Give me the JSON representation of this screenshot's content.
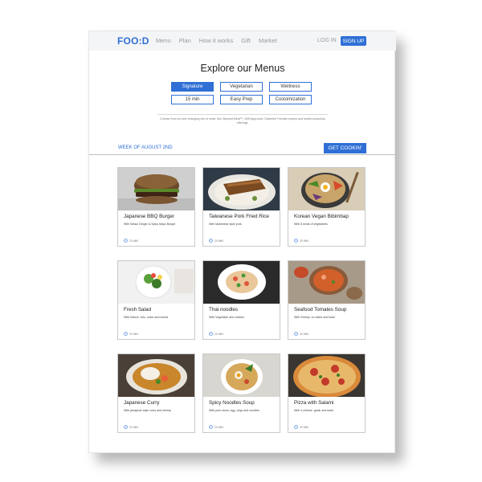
{
  "brand": {
    "logo": "FOO:D",
    "accent": "#2f6fd6"
  },
  "nav": [
    "Menu",
    "Plan",
    "How it works",
    "Gift",
    "Market"
  ],
  "auth": {
    "login": "LOG IN",
    "signup": "SIGN UP"
  },
  "hero": {
    "title": "Explore our Menus"
  },
  "filters": [
    {
      "label": "Signature",
      "active": true
    },
    {
      "label": "Vegetarian",
      "active": false
    },
    {
      "label": "Wellness",
      "active": false
    },
    {
      "label": "15 min",
      "active": false
    },
    {
      "label": "Easy Prep",
      "active": false
    },
    {
      "label": "Customization",
      "active": false
    }
  ],
  "description": "Choose from an ever-changing mix of meat, fish, Beyond Meat™, WW Approved, Diabetes Friendly recipes and health-conscious offerings.",
  "week": {
    "label": "WEEK OF AUGUST 2ND",
    "cta": "GET COOKIN'"
  },
  "menu": [
    {
      "name": "Japanese BBQ Burger",
      "sub": "With Wasui Ginger & Spicy Mayo Burger",
      "time": "20 MIN",
      "icon": "burger-photo"
    },
    {
      "name": "Taiwanese Pork Fried Rice",
      "sub": "With taiwanese style pork",
      "time": "20 MIN",
      "icon": "pork-rice-photo"
    },
    {
      "name": "Korean Vegan Bibimbap",
      "sub": "With 8 kinds of vegetables",
      "time": "20 MIN",
      "icon": "bibimbap-photo"
    },
    {
      "name": "Fresh Salad",
      "sub": "With lettuce, tofu, onion and seeds",
      "time": "20 MIN",
      "icon": "salad-photo"
    },
    {
      "name": "Thai noodles",
      "sub": "With Vegetable and chicken",
      "time": "20 MIN",
      "icon": "thai-noodles-photo"
    },
    {
      "name": "Seafood Tomates Soup",
      "sub": "With Shrimp, to mates and basil",
      "time": "20 MIN",
      "icon": "tomato-soup-photo"
    },
    {
      "name": "Japanese Curry",
      "sub": "With janapese style curry and shrimp",
      "time": "20 MIN",
      "icon": "curry-photo"
    },
    {
      "name": "Spicy Noodles Soup",
      "sub": "With pork stock, egg, vegs and noodles",
      "time": "20 MIN",
      "icon": "noodle-soup-photo"
    },
    {
      "name": "Pizza with Salami",
      "sub": "With 4 cheese, garlic and basil",
      "time": "20 MIN",
      "icon": "pizza-photo"
    }
  ]
}
